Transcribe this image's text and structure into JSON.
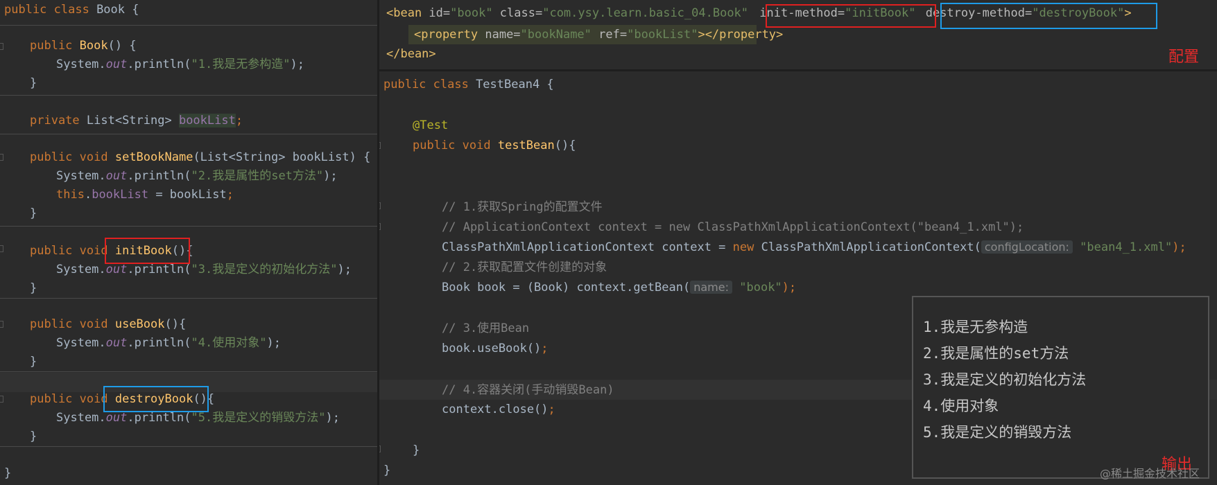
{
  "left_code": {
    "l1": {
      "kw": "public class",
      "name": " Book {"
    },
    "l2": {
      "kw": "public",
      "fn": "Book",
      "rest": "() {"
    },
    "l3": {
      "pre": "System.",
      "fi": "out",
      "mid": ".println(",
      "str": "\"1.我是无参构造\"",
      "end": ");"
    },
    "l4": "}",
    "l5": {
      "kw": "private",
      "type": " List<String> ",
      "fld": "bookList",
      "end": ";"
    },
    "l6": {
      "kw": "public void",
      "fn": "setBookName",
      "rest": "(List<String> bookList) {"
    },
    "l7": {
      "pre": "System.",
      "fi": "out",
      "mid": ".println(",
      "str": "\"2.我是属性的set方法\"",
      "end": ");"
    },
    "l8": {
      "kw": "this",
      "dot": ".",
      "fld": "bookList",
      "rest": " = bookList",
      "end": ";"
    },
    "l9": "}",
    "l10": {
      "kw": "public void",
      "fn": "initBook",
      "rest": "(){"
    },
    "l11": {
      "pre": "System.",
      "fi": "out",
      "mid": ".println(",
      "str": "\"3.我是定义的初始化方法\"",
      "end": ");"
    },
    "l12": "}",
    "l13": {
      "kw": "public void",
      "fn": "useBook",
      "rest": "(){"
    },
    "l14": {
      "pre": "System.",
      "fi": "out",
      "mid": ".println(",
      "str": "\"4.使用对象\"",
      "end": ");"
    },
    "l15": "}",
    "l16": {
      "kw": "public void",
      "fn": "destroyBook",
      "rest": "(){"
    },
    "l17": {
      "pre": "System.",
      "fi": "out",
      "mid": ".println(",
      "str": "\"5.我是定义的销毁方法\"",
      "end": ");"
    },
    "l18": "}",
    "l19": "}"
  },
  "xml": {
    "x1": {
      "open": "<bean ",
      "a1": "id=",
      "v1": "\"book\"",
      "a2": " class=",
      "v2": "\"com.ysy.learn.basic_04.Book\"",
      "a3": "init-method=",
      "v3": "\"initBook\"",
      "a4": "destroy-method=",
      "v4": "\"destroyBook\"",
      "close": ">"
    },
    "x2": {
      "open": "<property ",
      "a1": "name=",
      "v1": "\"bookName\"",
      "a2": " ref=",
      "v2": "\"bookList\"",
      "close": "></property>"
    },
    "x3": "</bean>",
    "label": "配置"
  },
  "right_code": {
    "r1": {
      "kw": "public class",
      "name": " TestBean4 {"
    },
    "r2": "@Test",
    "r3": {
      "kw": "public void",
      "fn": "testBean",
      "rest": "(){"
    },
    "r4": "// 1.获取Spring的配置文件",
    "r5": "// ApplicationContext context = new ClassPathXmlApplicationContext(\"bean4_1.xml\");",
    "r6": {
      "pre": "ClassPathXmlApplicationContext context = ",
      "kw": "new",
      "mid": " ClassPathXmlApplicationContext(",
      "hint": "configLocation:",
      "str": "\"bean4_1.xml\"",
      "end": ");"
    },
    "r7": "// 2.获取配置文件创建的对象",
    "r8": {
      "pre": "Book book = (Book) context.getBean(",
      "hint": "name:",
      "str": "\"book\"",
      "end": ");"
    },
    "r9": "// 3.使用Bean",
    "r10": {
      "pre": "book.useBook()",
      "end": ";"
    },
    "r11": "// 4.容器关闭(手动销毁Bean)",
    "r12": {
      "pre": "context.close()",
      "end": ";"
    },
    "r13": "}",
    "r14": "}"
  },
  "output": {
    "lines": [
      "1.我是无参构造",
      "2.我是属性的set方法",
      "3.我是定义的初始化方法",
      "4.使用对象",
      "5.我是定义的销毁方法"
    ],
    "label": "输出"
  },
  "watermark": "@稀土掘金技术社区",
  "colors": {
    "highlight_red": "#e02020",
    "highlight_blue": "#1e9be8",
    "editor_bg": "#2b2b2b"
  }
}
